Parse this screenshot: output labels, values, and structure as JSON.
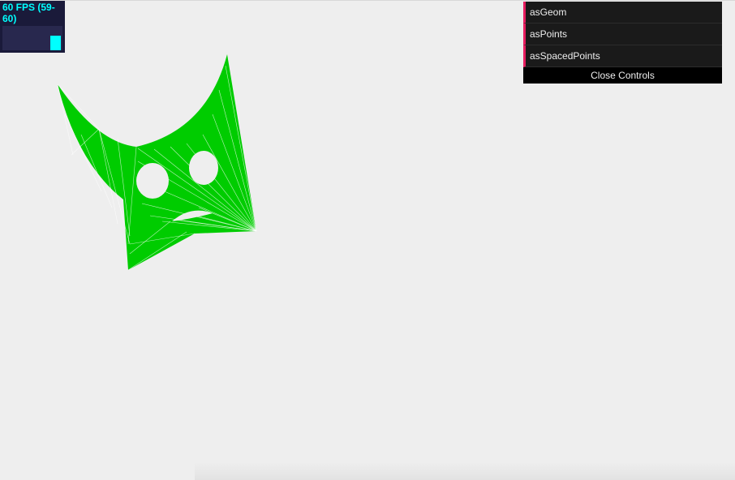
{
  "stats": {
    "fps_text": "60 FPS (59-60)",
    "fps_level": 0.6
  },
  "gui": {
    "items": [
      {
        "label": "asGeom"
      },
      {
        "label": "asPoints"
      },
      {
        "label": "asSpacedPoints"
      }
    ],
    "close_label": "Close Controls",
    "accent_color": "#e61d5f"
  },
  "scene": {
    "shape_color": "#00cc00",
    "background_color": "#eeeeee"
  }
}
